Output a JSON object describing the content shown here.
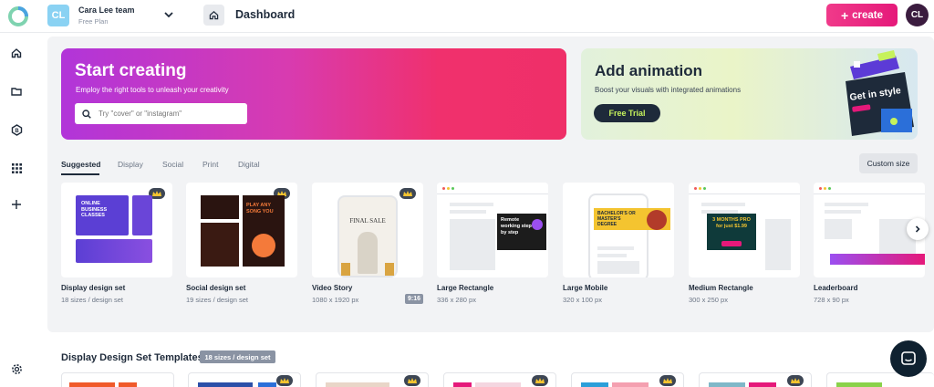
{
  "topbar": {
    "team_initials": "CL",
    "team_name": "Cara Lee team",
    "team_plan": "Free Plan",
    "page_title": "Dashboard",
    "create_label": "create",
    "user_initials": "CL"
  },
  "sidebar": {
    "items": [
      {
        "icon": "home-icon"
      },
      {
        "icon": "folder-icon"
      },
      {
        "icon": "brand-icon"
      },
      {
        "icon": "apps-grid-icon"
      },
      {
        "icon": "plus-icon"
      },
      {
        "icon": "settings-icon"
      }
    ]
  },
  "hero": {
    "create": {
      "title": "Start creating",
      "subtitle": "Employ the right tools to unleash your creativity",
      "search_placeholder": "Try \"cover\" or \"instagram\""
    },
    "animation": {
      "title": "Add animation",
      "subtitle": "Boost your visuals with integrated animations",
      "cta": "Free Trial",
      "art_text": "Get in style"
    }
  },
  "tabs": {
    "items": [
      "Suggested",
      "Display",
      "Social",
      "Print",
      "Digital"
    ],
    "active": "Suggested",
    "custom_size": "Custom size"
  },
  "cards": [
    {
      "name": "Display design set",
      "size": "18 sizes / design set",
      "premium": true,
      "thumb_text": "ONLINE BUSINESS CLASSES"
    },
    {
      "name": "Social design set",
      "size": "19 sizes / design set",
      "premium": true,
      "thumb_text": "PLAY ANY SONG YOU"
    },
    {
      "name": "Video Story",
      "size": "1080 x 1920 px",
      "premium": true,
      "badge": "9:16",
      "thumb_text": "FINAL SALE"
    },
    {
      "name": "Large Rectangle",
      "size": "336 x 280 px",
      "premium": false,
      "thumb_text": "Remote working step by step"
    },
    {
      "name": "Large Mobile",
      "size": "320 x 100 px",
      "premium": false,
      "thumb_text": "BACHELOR'S OR MASTER'S DEGREE"
    },
    {
      "name": "Medium Rectangle",
      "size": "300 x 250 px",
      "premium": false,
      "thumb_text": "3 MONTHS PRO for just $1.99"
    },
    {
      "name": "Leaderboard",
      "size": "728 x 90 px",
      "premium": false,
      "thumb_text": ""
    }
  ],
  "templates_section": {
    "title": "Display Design Set Templates",
    "badge": "18 sizes / design set"
  },
  "colors": {
    "brand_pink": "#e5197a",
    "dark_navy": "#1e2a3a",
    "trial_green": "#c6f25c"
  }
}
